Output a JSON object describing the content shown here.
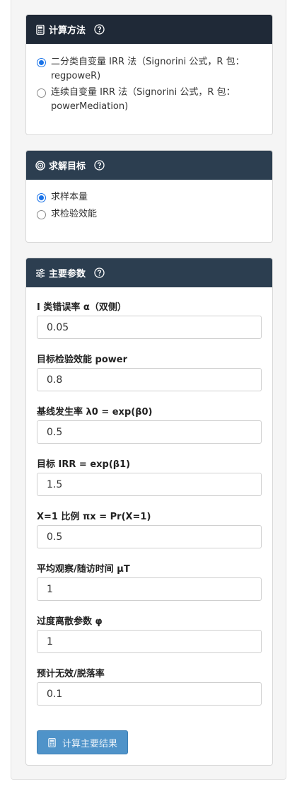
{
  "method": {
    "title": "计算方法",
    "options": [
      {
        "label": "二分类自变量 IRR 法（Signorini 公式，R 包：regpoweR)",
        "checked": true
      },
      {
        "label": "连续自变量 IRR 法（Signorini 公式，R 包：powerMediation)",
        "checked": false
      }
    ]
  },
  "goal": {
    "title": "求解目标",
    "options": [
      {
        "label": "求样本量",
        "checked": true
      },
      {
        "label": "求检验效能",
        "checked": false
      }
    ]
  },
  "params": {
    "title": "主要参数",
    "fields": [
      {
        "label": "I 类错误率 α（双侧）",
        "value": "0.05"
      },
      {
        "label": "目标检验效能 power",
        "value": "0.8"
      },
      {
        "label": "基线发生率 λ0 = exp(β0)",
        "value": "0.5"
      },
      {
        "label": "目标 IRR = exp(β1)",
        "value": "1.5"
      },
      {
        "label": "X=1 比例 πx = Pr(X=1)",
        "value": "0.5"
      },
      {
        "label": "平均观察/随访时间 μT",
        "value": "1"
      },
      {
        "label": "过度离散参数 φ",
        "value": "1"
      },
      {
        "label": "预计无效/脱落率",
        "value": "0.1"
      }
    ],
    "button_label": "计算主要结果"
  },
  "icons": {
    "method": "calculator-icon",
    "goal": "target-icon",
    "params": "sliders-icon",
    "help": "question-circle-icon",
    "button": "calculator-icon"
  },
  "colors": {
    "header_dark": "#1f2937",
    "header_blue": "#2c3e50",
    "accent": "#1a73e8",
    "button": "#4f93c9"
  }
}
